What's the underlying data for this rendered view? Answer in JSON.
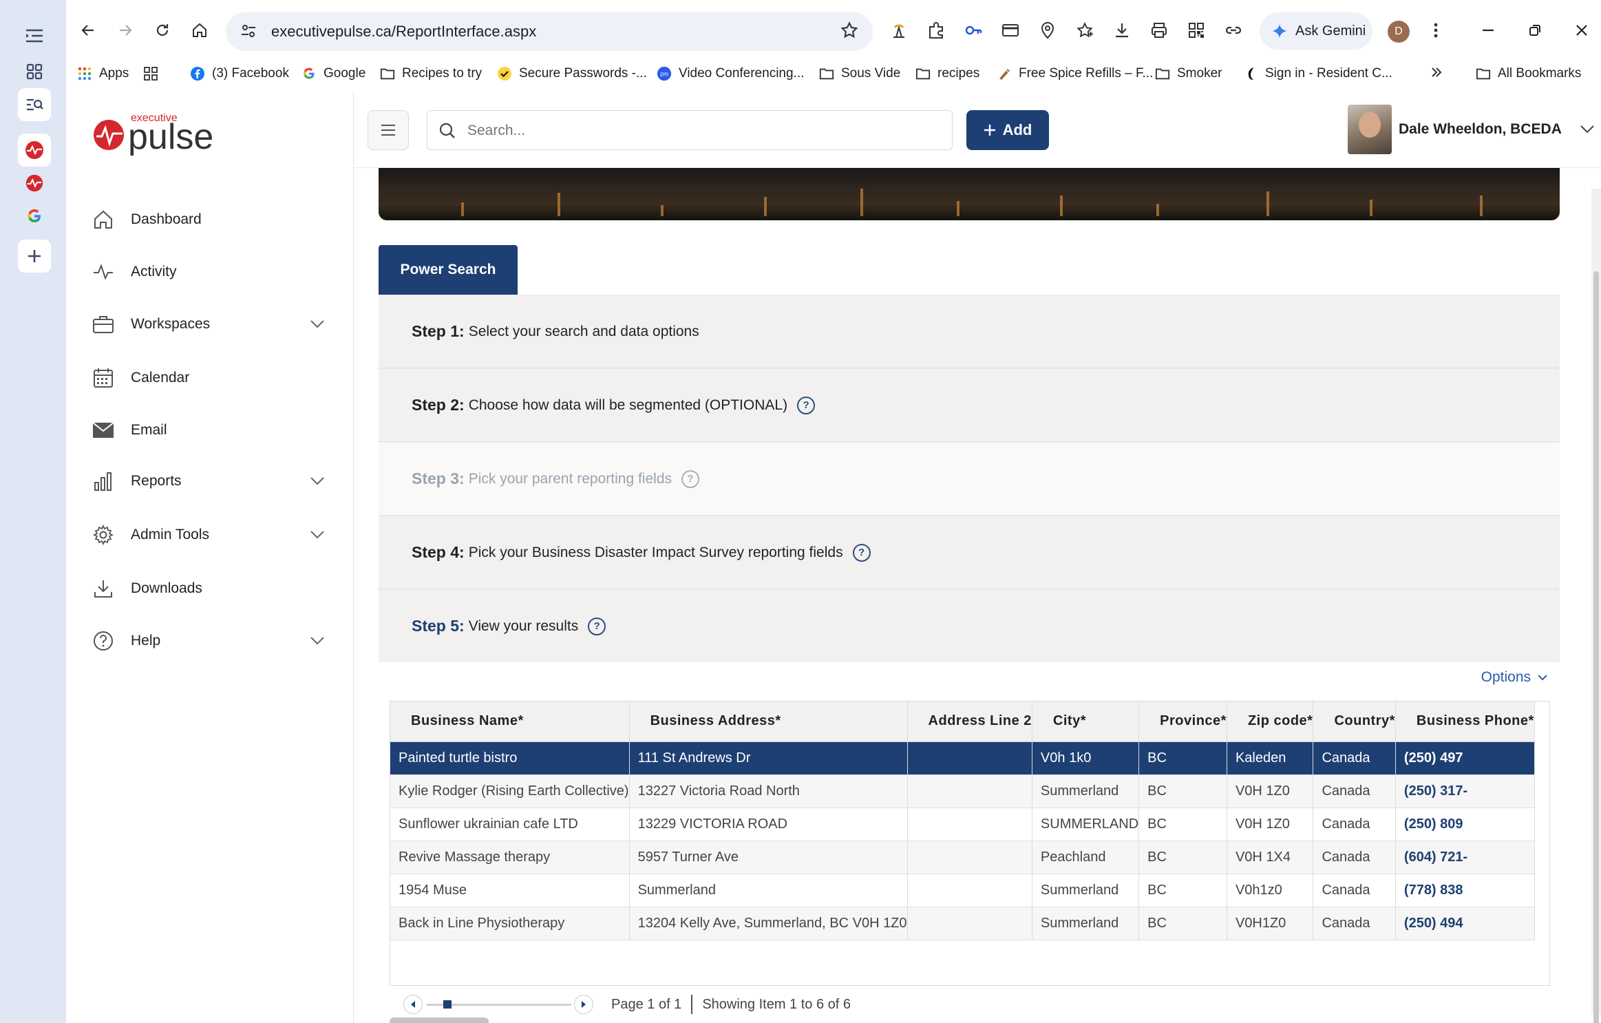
{
  "browser": {
    "url": "executivepulse.ca/ReportInterface.aspx",
    "gemini_label": "Ask Gemini",
    "profile_initial": "D"
  },
  "bookmarks": [
    {
      "label": "Apps",
      "icon": "apps-grid-icon"
    },
    {
      "label": "",
      "icon": "grid-icon"
    },
    {
      "label": "(3) Facebook",
      "icon": "facebook-icon"
    },
    {
      "label": "Google",
      "icon": "google-icon"
    },
    {
      "label": "Recipes to try",
      "icon": "folder-icon"
    },
    {
      "label": "Secure Passwords -...",
      "icon": "check-icon"
    },
    {
      "label": "Video Conferencing...",
      "icon": "zoom-icon"
    },
    {
      "label": "Sous Vide",
      "icon": "folder-icon"
    },
    {
      "label": "recipes",
      "icon": "folder-icon"
    },
    {
      "label": "Free Spice Refills – F...",
      "icon": "spice-icon"
    },
    {
      "label": "Smoker",
      "icon": "folder-icon"
    },
    {
      "label": "Sign in - Resident C...",
      "icon": "resident-icon"
    },
    {
      "label": "All Bookmarks",
      "icon": "folder-icon"
    }
  ],
  "sidebar": {
    "logo_top": "executive",
    "logo_main": "pulse",
    "items": [
      {
        "label": "Dashboard",
        "icon": "home-icon",
        "expandable": false
      },
      {
        "label": "Activity",
        "icon": "activity-icon",
        "expandable": false
      },
      {
        "label": "Workspaces",
        "icon": "briefcase-icon",
        "expandable": true
      },
      {
        "label": "Calendar",
        "icon": "calendar-icon",
        "expandable": false
      },
      {
        "label": "Email",
        "icon": "envelope-icon",
        "expandable": false
      },
      {
        "label": "Reports",
        "icon": "bar-chart-icon",
        "expandable": true
      },
      {
        "label": "Admin Tools",
        "icon": "gear-icon",
        "expandable": true
      },
      {
        "label": "Downloads",
        "icon": "download-icon",
        "expandable": false
      },
      {
        "label": "Help",
        "icon": "help-icon",
        "expandable": true
      }
    ]
  },
  "topbar": {
    "search_placeholder": "Search...",
    "add_label": "Add",
    "user_name": "Dale Wheeldon, BCEDA"
  },
  "report": {
    "tab_label": "Power Search",
    "steps": [
      {
        "num": "Step 1:",
        "text": "Select your search and data options",
        "help": false,
        "disabled": false
      },
      {
        "num": "Step 2:",
        "text": "Choose how data will be segmented (OPTIONAL)",
        "help": true,
        "disabled": false
      },
      {
        "num": "Step 3:",
        "text": "Pick your parent reporting fields",
        "help": true,
        "disabled": true
      },
      {
        "num": "Step 4:",
        "text": "Pick your Business Disaster Impact Survey reporting fields",
        "help": true,
        "disabled": false
      },
      {
        "num": "Step 5:",
        "text": "View your results",
        "help": true,
        "disabled": false
      }
    ],
    "options_label": "Options",
    "columns": [
      "Business Name*",
      "Business Address*",
      "Address Line 2",
      "City*",
      "Province*",
      "Zip code*",
      "Country*",
      "Business Phone*"
    ],
    "rows": [
      [
        "Painted turtle bistro",
        "111 St Andrews Dr",
        "",
        "V0h 1k0",
        "BC",
        "Kaleden",
        "Canada",
        "(250) 497"
      ],
      [
        "Kylie Rodger (Rising Earth Collective)",
        "13227 Victoria Road North",
        "",
        "Summerland",
        "BC",
        "V0H 1Z0",
        "Canada",
        "(250) 317-"
      ],
      [
        "Sunflower ukrainian cafe LTD",
        "13229 VICTORIA ROAD",
        "",
        "SUMMERLAND",
        "BC",
        "V0H 1Z0",
        "Canada",
        "(250) 809"
      ],
      [
        "Revive Massage therapy",
        "5957 Turner Ave",
        "",
        "Peachland",
        "BC",
        "V0H 1X4",
        "Canada",
        "(604) 721-"
      ],
      [
        "1954 Muse",
        "Summerland",
        "",
        "Summerland",
        "BC",
        "V0h1z0",
        "Canada",
        "(778) 838"
      ],
      [
        "Back in Line Physiotherapy",
        "13204 Kelly Ave, Summerland, BC V0H 1Z0",
        "",
        "Summerland",
        "BC",
        "V0H1Z0",
        "Canada",
        "(250) 494"
      ]
    ],
    "selected_row": 0,
    "page_text": "Page 1 of 1",
    "showing_text": "Showing Item 1 to 6 of 6"
  },
  "colors": {
    "brand": "#1d3f73",
    "accent_red": "#d6262e",
    "link": "#2d5ba8"
  }
}
